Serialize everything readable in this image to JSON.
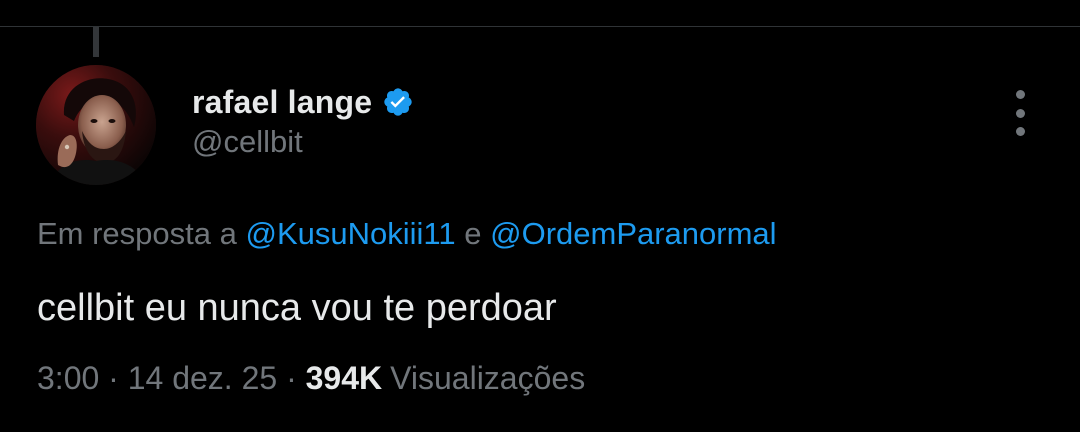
{
  "tweet": {
    "author": {
      "display_name": "rafael lange",
      "handle": "@cellbit",
      "verified": true,
      "avatar_icon": "profile-photo"
    },
    "reply_context": {
      "prefix": "Em resposta a",
      "mention_1": "@KusuNokiii11",
      "conjunction": "e",
      "mention_2": "@OrdemParanormal"
    },
    "text": "cellbit eu nunca vou te perdoar",
    "meta": {
      "time": "3:00",
      "separator": "·",
      "date": "14 dez. 25",
      "views_count": "394K",
      "views_label": "Visualizações"
    },
    "more_icon": "more-vertical-icon"
  },
  "colors": {
    "background": "#000000",
    "text_primary": "#e7e9ea",
    "text_secondary": "#71767b",
    "accent": "#1d9bf0",
    "divider": "#2f3336"
  }
}
